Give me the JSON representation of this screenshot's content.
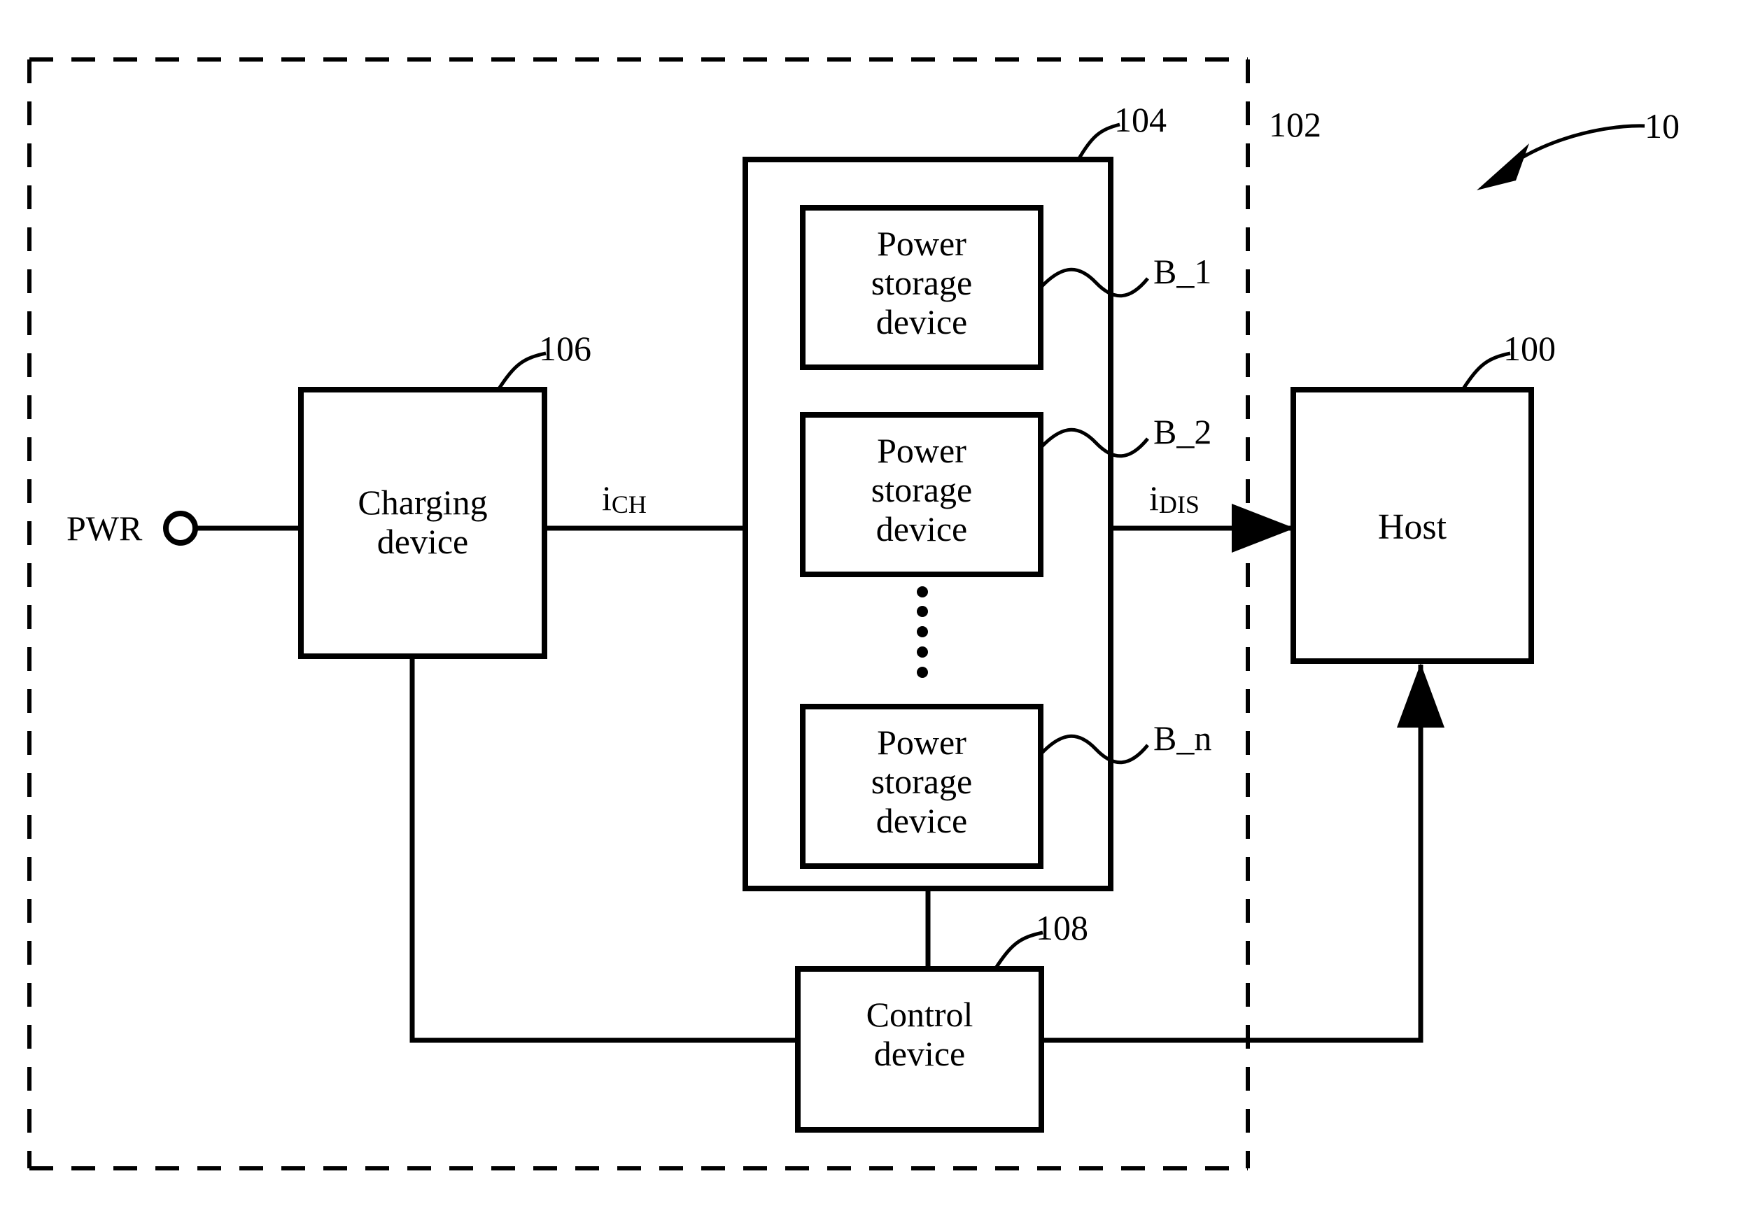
{
  "figure": {
    "system_ref": "10",
    "enclosure_ref": "102",
    "host": {
      "label": "Host",
      "ref": "100"
    },
    "charging_device": {
      "label_line1": "Charging",
      "label_line2": "device",
      "ref": "106"
    },
    "power_storage_unit": {
      "ref": "104",
      "cells": [
        {
          "label_line1": "Power",
          "label_line2": "storage",
          "label_line3": "device",
          "ref": "B_1"
        },
        {
          "label_line1": "Power",
          "label_line2": "storage",
          "label_line3": "device",
          "ref": "B_2"
        },
        {
          "label_line1": "Power",
          "label_line2": "storage",
          "label_line3": "device",
          "ref": "B_n"
        }
      ],
      "ellipsis": "⋮"
    },
    "control_device": {
      "label_line1": "Control",
      "label_line2": "device",
      "ref": "108"
    },
    "power_terminal": {
      "label": "PWR"
    },
    "currents": {
      "charge": {
        "symbol": "i",
        "subscript": "CH"
      },
      "discharge": {
        "symbol": "i",
        "subscript": "DIS"
      }
    }
  },
  "colors": {
    "ink": "#000000",
    "paper": "#ffffff"
  }
}
